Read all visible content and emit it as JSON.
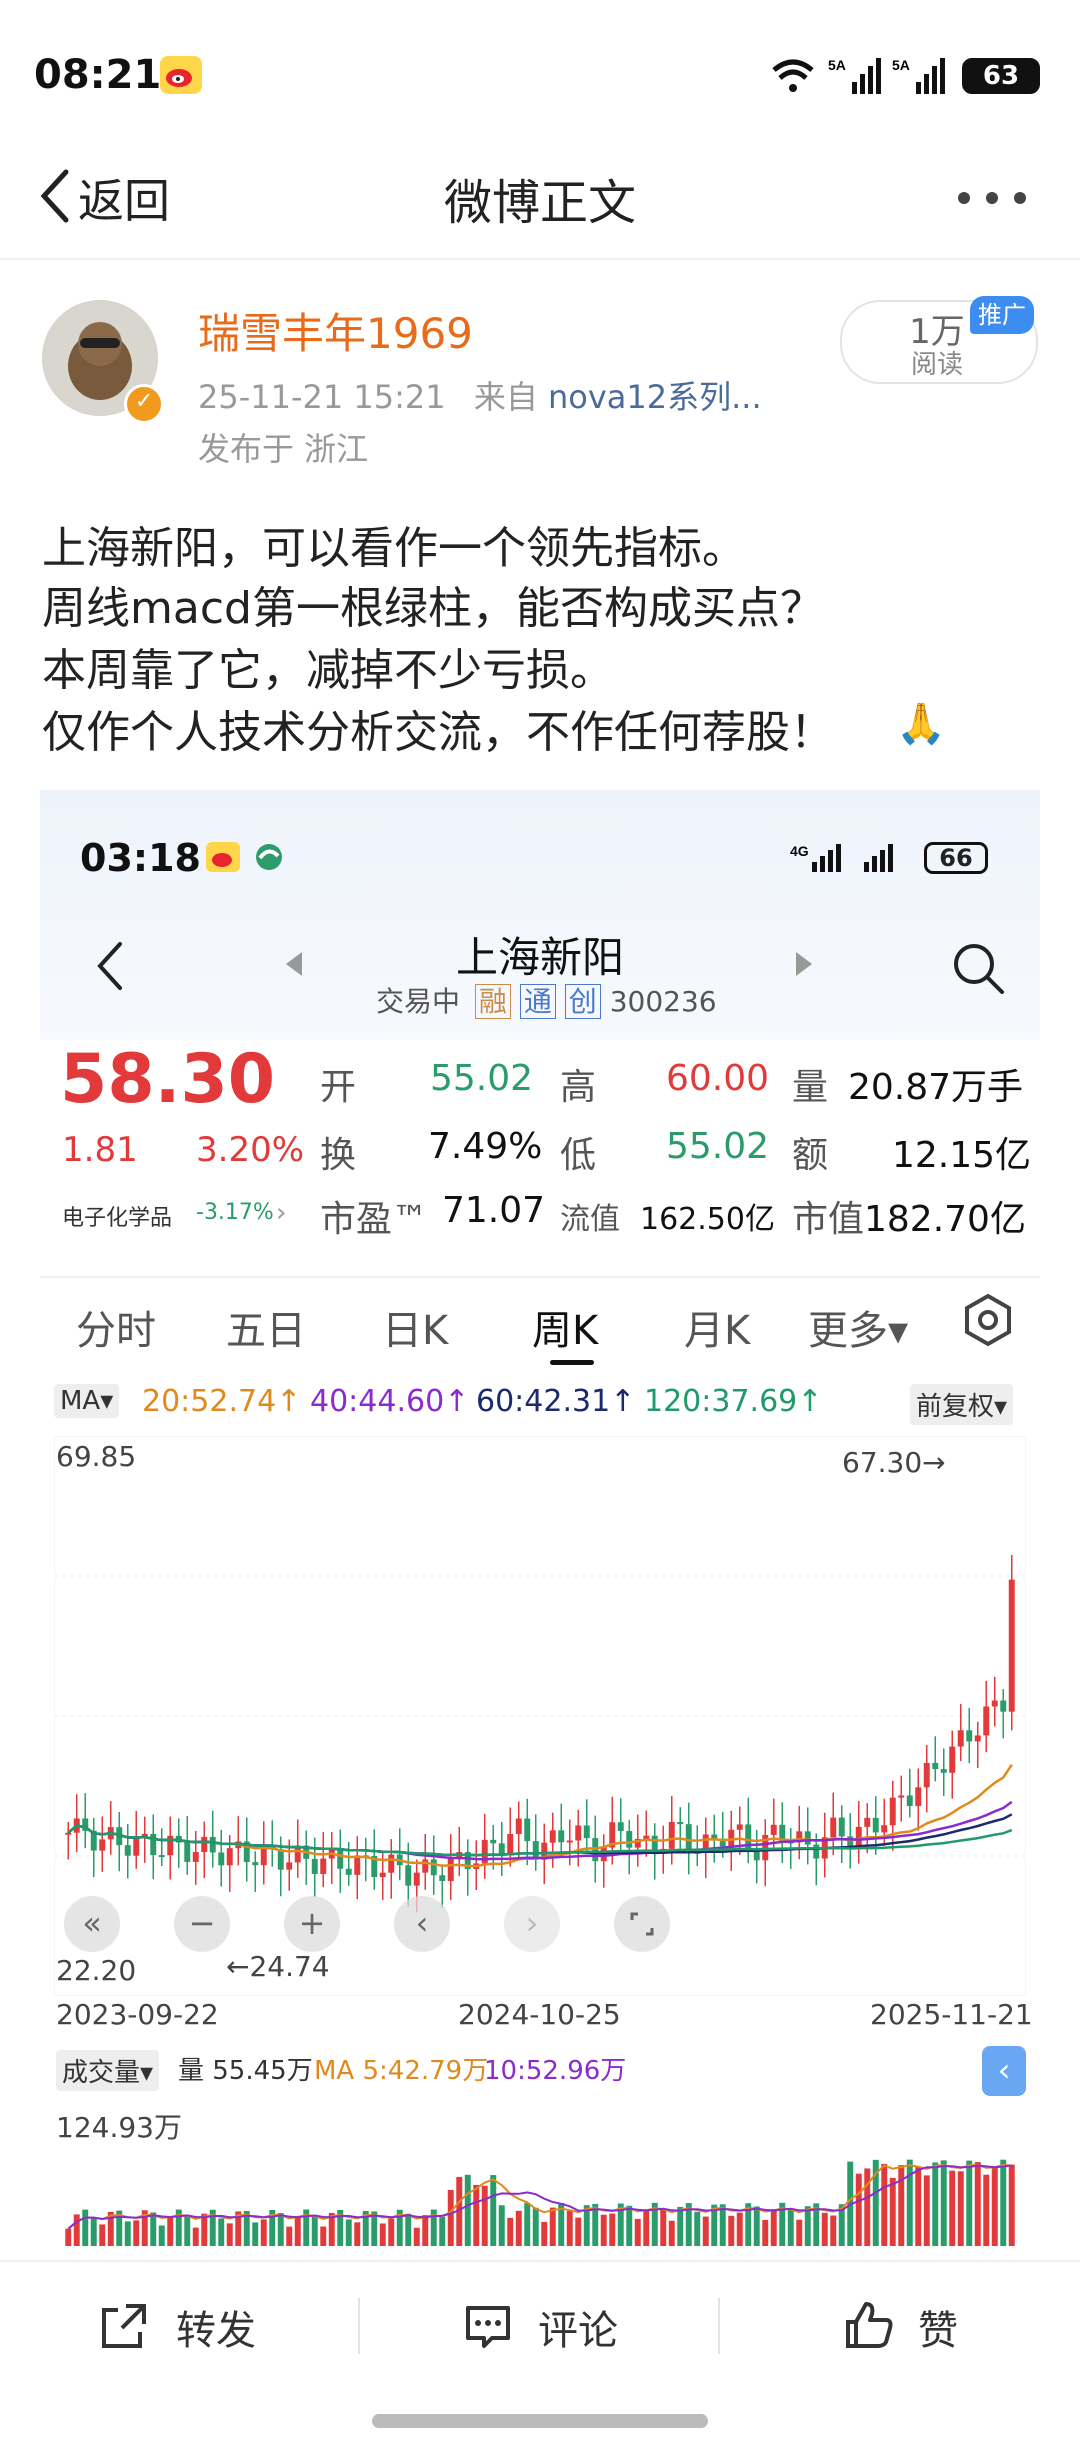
{
  "status": {
    "time": "08:21",
    "network1": "5G",
    "network2": "5G",
    "battery": "63"
  },
  "nav": {
    "back_label": "返回",
    "title": "微博正文"
  },
  "post": {
    "username": "瑞雪丰年1969",
    "date": "25-11-21 15:21",
    "source_prefix": "来自",
    "source": "nova12系列...",
    "location": "发布于 浙江",
    "views_count": "1万",
    "views_label": "阅读",
    "promo_badge": "推广",
    "lines": [
      "上海新阳，可以看作一个领先指标。",
      "周线macd第一根绿柱，能否构成买点？",
      "本周靠了它，减掉不少亏损。",
      "仅作个人技术分析交流，不作任何荐股！"
    ]
  },
  "shot": {
    "status_time": "03:18",
    "battery": "66",
    "stock_name": "上海新阳",
    "status": "交易中",
    "tags": [
      "融",
      "通",
      "创"
    ],
    "code": "300236",
    "price": "58.30",
    "change": "1.81",
    "change_pct": "3.20%",
    "sector": "电子化学品",
    "sector_pct": "-3.17%",
    "quotes": [
      {
        "label": "开",
        "value": "55.02",
        "color": "green"
      },
      {
        "label": "高",
        "value": "60.00",
        "color": "red"
      },
      {
        "label": "量",
        "value": "20.87万手",
        "color": "black"
      },
      {
        "label": "换",
        "value": "7.49%",
        "color": "black"
      },
      {
        "label": "低",
        "value": "55.02",
        "color": "green"
      },
      {
        "label": "额",
        "value": "12.15亿",
        "color": "black"
      },
      {
        "label": "市盈™",
        "value": "71.07",
        "color": "black"
      },
      {
        "label": "流值",
        "value": "162.50亿",
        "color": "black"
      },
      {
        "label": "市值",
        "value": "182.70亿",
        "color": "black"
      }
    ],
    "tabs": [
      "分时",
      "五日",
      "日K",
      "周K",
      "月K",
      "更多▾"
    ],
    "active_tab": "周K",
    "ma_selector": "MA▾",
    "ma": [
      {
        "label": "20:52.74↑",
        "color": "#e08a1e"
      },
      {
        "label": "40:44.60↑",
        "color": "#8a2bd0"
      },
      {
        "label": "60:42.31↑",
        "color": "#1a2a6c"
      },
      {
        "label": "120:37.69↑",
        "color": "#1f9a6a"
      }
    ],
    "adjust": "前复权▾",
    "y_max_label": "69.85",
    "y_min_label": "22.20",
    "high_mark": "67.30→",
    "low_mark": "←24.74",
    "dates": [
      "2023-09-22",
      "2024-10-25",
      "2025-11-21"
    ],
    "vol_label": "成交量▾",
    "vol_value": "量 55.45万",
    "vol_ma5": "MA 5:42.79万",
    "vol_ma10": "10:52.96万",
    "vol_max": "124.93万"
  },
  "chart_data": {
    "type": "candlestick",
    "title": "上海新阳 周K",
    "x_start": "2023-09-22",
    "x_end": "2025-11-21",
    "ylim": [
      22.2,
      69.85
    ],
    "high_marker": 67.3,
    "low_marker": 24.74,
    "last_close": 58.3
  },
  "actions": {
    "repost": "转发",
    "comment": "评论",
    "like": "赞"
  }
}
